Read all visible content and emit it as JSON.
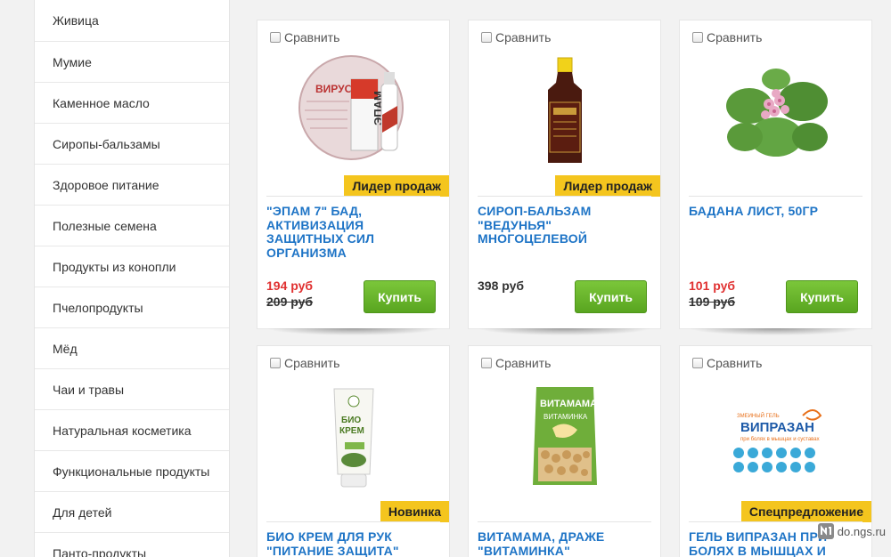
{
  "sidebar": {
    "items": [
      {
        "label": "Живица"
      },
      {
        "label": "Мумие"
      },
      {
        "label": "Каменное масло"
      },
      {
        "label": "Сиропы-бальзамы"
      },
      {
        "label": "Здоровое питание"
      },
      {
        "label": "Полезные семена"
      },
      {
        "label": "Продукты из конопли"
      },
      {
        "label": "Пчелопродукты"
      },
      {
        "label": "Мёд"
      },
      {
        "label": "Чаи и травы"
      },
      {
        "label": "Натуральная косметика"
      },
      {
        "label": "Функциональные продукты"
      },
      {
        "label": "Для детей"
      },
      {
        "label": "Панто-продукты"
      }
    ]
  },
  "compare_label": "Сравнить",
  "buy_label": "Купить",
  "products": [
    {
      "title": "\"ЭПАМ 7\" БАД, АКТИВИЗАЦИЯ ЗАЩИТНЫХ СИЛ ОРГАНИЗМА",
      "price": "194 руб",
      "old_price": "209 руб",
      "badge": "Лидер продаж",
      "image": "epam-7-bottle-image"
    },
    {
      "title": "СИРОП-БАЛЬЗАМ \"ВЕДУНЬЯ\" МНОГОЦЕЛЕВОЙ",
      "price": "398 руб",
      "old_price": "",
      "badge": "Лидер продаж",
      "image": "syrup-bottle-image"
    },
    {
      "title": "БАДАНА ЛИСТ, 50ГР",
      "price": "101 руб",
      "old_price": "109 руб",
      "badge": "",
      "image": "badan-plant-image"
    },
    {
      "title": "БИО КРЕМ ДЛЯ РУК \"ПИТАНИЕ ЗАЩИТА\"",
      "price": "",
      "old_price": "",
      "badge": "Новинка",
      "image": "bio-cream-tube-image"
    },
    {
      "title": "ВИТАМАМА, ДРАЖЕ \"ВИТАМИНКА\"",
      "price": "",
      "old_price": "",
      "badge": "",
      "image": "vitamama-pack-image"
    },
    {
      "title": "ГЕЛЬ ВИПРАЗАН ПРИ БОЛЯХ В МЫШЦАХ И",
      "price": "",
      "old_price": "",
      "badge": "Спецпредложение",
      "image": "viprazan-gel-image"
    }
  ],
  "watermark": "do.ngs.ru",
  "colors": {
    "accent_blue": "#1e74c6",
    "sale_red": "#e03131",
    "buy_green": "#6cb52d",
    "badge_yellow": "#f4c51e"
  }
}
